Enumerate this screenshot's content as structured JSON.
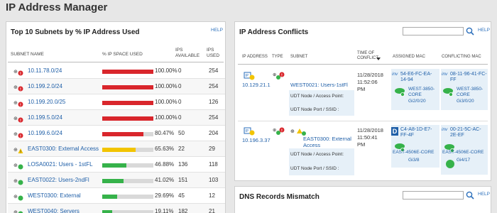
{
  "page": {
    "title": "IP Address Manager"
  },
  "subnets_panel": {
    "title": "Top 10 Subnets by % IP Address Used",
    "help": "HELP",
    "columns": {
      "name": "SUBNET NAME",
      "space": "% IP SPACE USED",
      "available": "IPS AVAILABLE",
      "used": "IPS USED"
    },
    "rows": [
      {
        "name": "10.11.78.0/24",
        "pct_label": "100.00%",
        "fill": 1.0,
        "color": "#d9262c",
        "available": "0",
        "used": "254",
        "status": "critical"
      },
      {
        "name": "10.199.2.0/24",
        "pct_label": "100.00%",
        "fill": 1.0,
        "color": "#d9262c",
        "available": "0",
        "used": "254",
        "status": "critical"
      },
      {
        "name": "10.199.20.0/25",
        "pct_label": "100.00%",
        "fill": 1.0,
        "color": "#d9262c",
        "available": "0",
        "used": "126",
        "status": "critical"
      },
      {
        "name": "10.199.5.0/24",
        "pct_label": "100.00%",
        "fill": 1.0,
        "color": "#d9262c",
        "available": "0",
        "used": "254",
        "status": "critical"
      },
      {
        "name": "10.199.6.0/24",
        "pct_label": "80.47%",
        "fill": 0.8047,
        "color": "#d9262c",
        "available": "50",
        "used": "204",
        "status": "critical"
      },
      {
        "name": "EAST0300: External Access",
        "pct_label": "65.63%",
        "fill": 0.6563,
        "color": "#f2c400",
        "available": "22",
        "used": "29",
        "status": "warning"
      },
      {
        "name": "LOSA0021: Users - 1stFL",
        "pct_label": "46.88%",
        "fill": 0.4688,
        "color": "#36b24a",
        "available": "136",
        "used": "118",
        "status": "ok"
      },
      {
        "name": "EAST0022: Users-2ndFl",
        "pct_label": "41.02%",
        "fill": 0.4102,
        "color": "#36b24a",
        "available": "151",
        "used": "103",
        "status": "ok"
      },
      {
        "name": "WEST0300: External",
        "pct_label": "29.69%",
        "fill": 0.2969,
        "color": "#36b24a",
        "available": "45",
        "used": "12",
        "status": "ok"
      },
      {
        "name": "WEST0040: Servers",
        "pct_label": "19.11%",
        "fill": 0.1911,
        "color": "#36b24a",
        "available": "182",
        "used": "21",
        "status": "ok"
      }
    ]
  },
  "conflicts_panel": {
    "title": "IP Address Conflicts",
    "help": "HELP",
    "search_placeholder": "",
    "columns": {
      "ip": "IP ADDRESS",
      "type": "TYPE",
      "subnet": "SUBNET",
      "time": "TIME OF CONFLICT",
      "assigned": "ASSIGNED MAC",
      "conflicting": "CONFLICTING MAC"
    },
    "rows": [
      {
        "ip": "10.129.21.1",
        "subnet": "WEST0021: Users-1stFl",
        "date": "11/28/2018",
        "time": "11:52:06",
        "ampm": "PM",
        "udt_node": "UDT Node / Access Point:",
        "udt_port": "UDT Node Port / SSID :",
        "assigned_vendor": "inv",
        "assigned_mac": "54-E6-FC-EA-14-94",
        "assigned_switch": "WEST-3850-CORE",
        "assigned_port": "Gi2/0/20",
        "conflicting_vendor": "inv",
        "conflicting_mac": "08-11-96-41-FC-FF",
        "conflicting_switch": "WEST-3850-CORE",
        "conflicting_port": "Gi3/0/20"
      },
      {
        "ip": "10.196.3.37",
        "subnet": "EAST0300: External Access",
        "date": "11/28/2018",
        "time": "11:50:41",
        "ampm": "PM",
        "udt_node": "UDT Node / Access Point:",
        "udt_port": "UDT Node Port / SSID :",
        "assigned_vendor": "D",
        "assigned_mac": "C4-A8-1D-E7-FF-4F",
        "assigned_switch": "EAST-4506E-CORE",
        "assigned_port": "Gi3/8",
        "conflicting_vendor": "inv",
        "conflicting_mac": "00-21-5C-AC-2E-EF",
        "conflicting_switch": "EAST-4506E-CORE",
        "conflicting_port": "Gi4/17"
      }
    ]
  },
  "dns_panel": {
    "title": "DNS Records Mismatch",
    "help": "HELP",
    "search_placeholder": ""
  }
}
